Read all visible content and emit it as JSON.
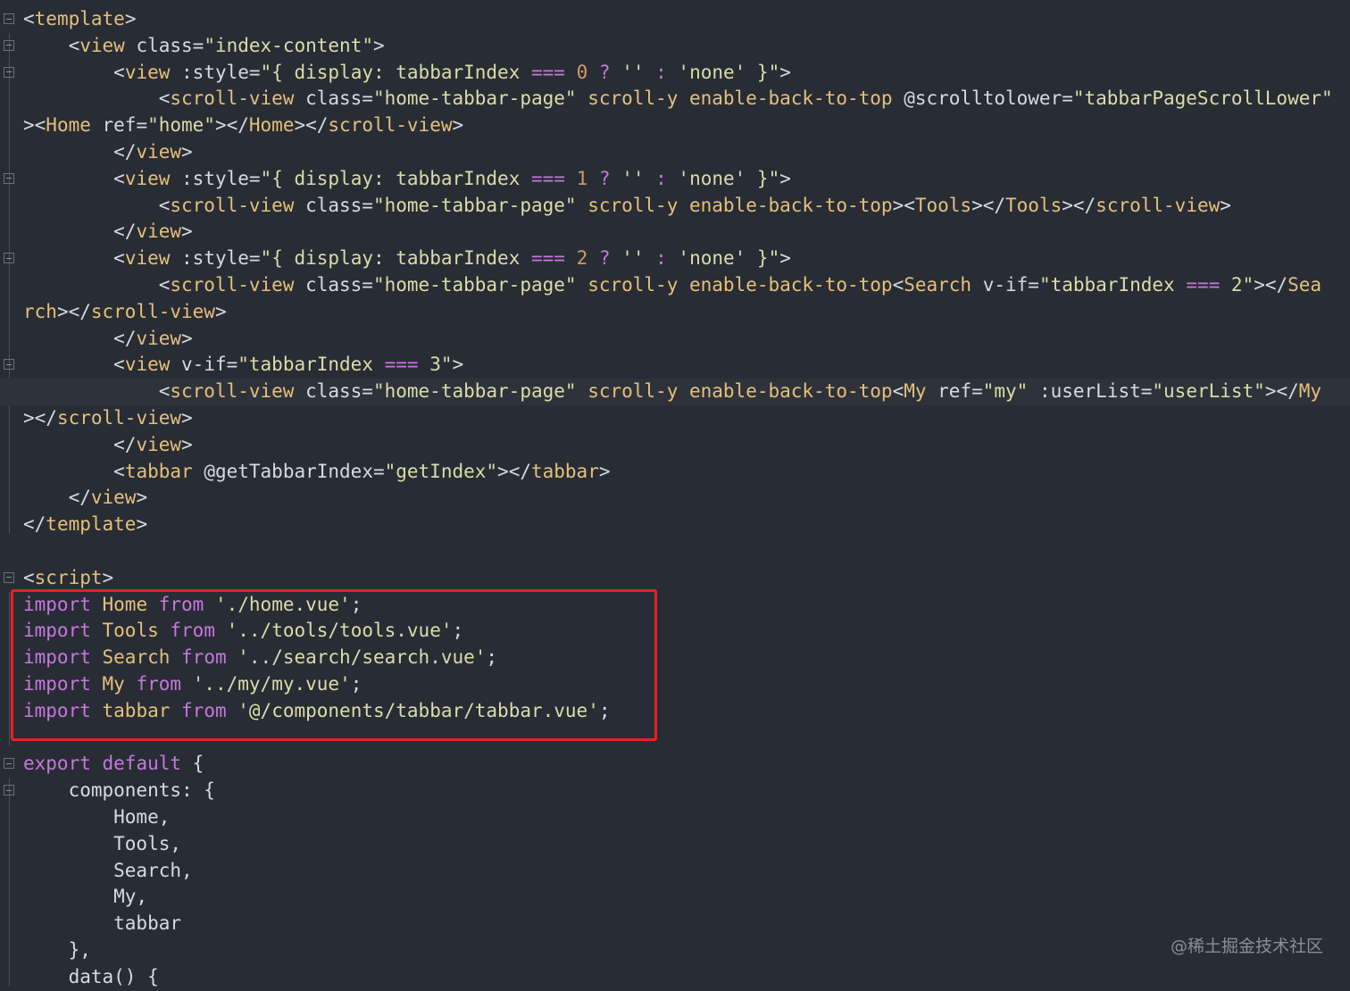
{
  "lines": [
    [
      [
        "t-bracket",
        "<"
      ],
      [
        "t-tag",
        "template"
      ],
      [
        "t-bracket",
        ">"
      ]
    ],
    [
      [
        "t-plain",
        "    "
      ],
      [
        "t-bracket",
        "<"
      ],
      [
        "t-tag",
        "view"
      ],
      [
        "t-attr",
        " class="
      ],
      [
        "t-str",
        "\"index-content\""
      ],
      [
        "t-bracket",
        ">"
      ]
    ],
    [
      [
        "t-plain",
        "        "
      ],
      [
        "t-bracket",
        "<"
      ],
      [
        "t-tag",
        "view"
      ],
      [
        "t-attr",
        " :style="
      ],
      [
        "t-str",
        "\"{ display: tabbarIndex "
      ],
      [
        "t-kw",
        "==="
      ],
      [
        "t-str",
        " "
      ],
      [
        "t-num",
        "0"
      ],
      [
        "t-str",
        " "
      ],
      [
        "t-kw",
        "?"
      ],
      [
        "t-str",
        " '' "
      ],
      [
        "t-kw",
        ":"
      ],
      [
        "t-str",
        " 'none' }\""
      ],
      [
        "t-bracket",
        ">"
      ]
    ],
    [
      [
        "t-plain",
        "            "
      ],
      [
        "t-bracket",
        "<"
      ],
      [
        "t-tag",
        "scroll-view"
      ],
      [
        "t-attr",
        " class="
      ],
      [
        "t-str",
        "\"home-tabbar-page\""
      ],
      [
        "t-tag",
        " scroll-y enable-back-to-top"
      ],
      [
        "t-attr",
        " @scrolltolower="
      ],
      [
        "t-str",
        "\"tabbarPageScrollLower\""
      ]
    ],
    [
      [
        "t-bracket",
        "><"
      ],
      [
        "t-tag",
        "Home"
      ],
      [
        "t-attr",
        " ref="
      ],
      [
        "t-str",
        "\"home\""
      ],
      [
        "t-bracket",
        "></"
      ],
      [
        "t-tag",
        "Home"
      ],
      [
        "t-bracket",
        "></"
      ],
      [
        "t-tag",
        "scroll-view"
      ],
      [
        "t-bracket",
        ">"
      ]
    ],
    [
      [
        "t-plain",
        "        "
      ],
      [
        "t-bracket",
        "</"
      ],
      [
        "t-tag",
        "view"
      ],
      [
        "t-bracket",
        ">"
      ]
    ],
    [
      [
        "t-plain",
        "        "
      ],
      [
        "t-bracket",
        "<"
      ],
      [
        "t-tag",
        "view"
      ],
      [
        "t-attr",
        " :style="
      ],
      [
        "t-str",
        "\"{ display: tabbarIndex "
      ],
      [
        "t-kw",
        "==="
      ],
      [
        "t-str",
        " "
      ],
      [
        "t-num",
        "1"
      ],
      [
        "t-str",
        " "
      ],
      [
        "t-kw",
        "?"
      ],
      [
        "t-str",
        " '' "
      ],
      [
        "t-kw",
        ":"
      ],
      [
        "t-str",
        " 'none' }\""
      ],
      [
        "t-bracket",
        ">"
      ]
    ],
    [
      [
        "t-plain",
        "            "
      ],
      [
        "t-bracket",
        "<"
      ],
      [
        "t-tag",
        "scroll-view"
      ],
      [
        "t-attr",
        " class="
      ],
      [
        "t-str",
        "\"home-tabbar-page\""
      ],
      [
        "t-tag",
        " scroll-y enable-back-to-top"
      ],
      [
        "t-bracket",
        "><"
      ],
      [
        "t-tag",
        "Tools"
      ],
      [
        "t-bracket",
        "></"
      ],
      [
        "t-tag",
        "Tools"
      ],
      [
        "t-bracket",
        "></"
      ],
      [
        "t-tag",
        "scroll-view"
      ],
      [
        "t-bracket",
        ">"
      ]
    ],
    [
      [
        "t-plain",
        "        "
      ],
      [
        "t-bracket",
        "</"
      ],
      [
        "t-tag",
        "view"
      ],
      [
        "t-bracket",
        ">"
      ]
    ],
    [
      [
        "t-plain",
        "        "
      ],
      [
        "t-bracket",
        "<"
      ],
      [
        "t-tag",
        "view"
      ],
      [
        "t-attr",
        " :style="
      ],
      [
        "t-str",
        "\"{ display: tabbarIndex "
      ],
      [
        "t-kw",
        "==="
      ],
      [
        "t-str",
        " "
      ],
      [
        "t-num",
        "2"
      ],
      [
        "t-str",
        " "
      ],
      [
        "t-kw",
        "?"
      ],
      [
        "t-str",
        " '' "
      ],
      [
        "t-kw",
        ":"
      ],
      [
        "t-str",
        " 'none' }\""
      ],
      [
        "t-bracket",
        ">"
      ]
    ],
    [
      [
        "t-plain",
        "            "
      ],
      [
        "t-bracket",
        "<"
      ],
      [
        "t-tag",
        "scroll-view"
      ],
      [
        "t-attr",
        " class="
      ],
      [
        "t-str",
        "\"home-tabbar-page\""
      ],
      [
        "t-tag",
        " scroll-y enable-back-to-top"
      ],
      [
        "t-bracket",
        "<"
      ],
      [
        "t-tag",
        "Search"
      ],
      [
        "t-attr",
        " v-if="
      ],
      [
        "t-str",
        "\"tabbarIndex "
      ],
      [
        "t-kw",
        "==="
      ],
      [
        "t-str",
        " 2\""
      ],
      [
        "t-bracket",
        "></"
      ],
      [
        "t-tag",
        "Sea"
      ]
    ],
    [
      [
        "t-tag",
        "rch"
      ],
      [
        "t-bracket",
        "></"
      ],
      [
        "t-tag",
        "scroll-view"
      ],
      [
        "t-bracket",
        ">"
      ]
    ],
    [
      [
        "t-plain",
        "        "
      ],
      [
        "t-bracket",
        "</"
      ],
      [
        "t-tag",
        "view"
      ],
      [
        "t-bracket",
        ">"
      ]
    ],
    [
      [
        "t-plain",
        "        "
      ],
      [
        "t-bracket",
        "<"
      ],
      [
        "t-tag",
        "view"
      ],
      [
        "t-attr",
        " v-if="
      ],
      [
        "t-str",
        "\"tabbarIndex "
      ],
      [
        "t-kw",
        "==="
      ],
      [
        "t-str",
        " 3\""
      ],
      [
        "t-bracket",
        ">"
      ]
    ],
    [
      [
        "t-plain",
        "            "
      ],
      [
        "t-bracket",
        "<"
      ],
      [
        "t-tag",
        "scroll-view"
      ],
      [
        "t-attr",
        " class="
      ],
      [
        "t-str",
        "\"home-tabbar-page\""
      ],
      [
        "t-tag",
        " scroll-y enable-back-to-top"
      ],
      [
        "t-bracket",
        "<"
      ],
      [
        "t-tag",
        "My"
      ],
      [
        "t-attr",
        " ref="
      ],
      [
        "t-str",
        "\"my\""
      ],
      [
        "t-attr",
        " :userList="
      ],
      [
        "t-str",
        "\"userList\""
      ],
      [
        "t-bracket",
        "></"
      ],
      [
        "t-tag",
        "My"
      ]
    ],
    [
      [
        "t-bracket",
        "></"
      ],
      [
        "t-tag",
        "scroll-view"
      ],
      [
        "t-bracket",
        ">"
      ]
    ],
    [
      [
        "t-plain",
        "        "
      ],
      [
        "t-bracket",
        "</"
      ],
      [
        "t-tag",
        "view"
      ],
      [
        "t-bracket",
        ">"
      ]
    ],
    [
      [
        "t-plain",
        "        "
      ],
      [
        "t-bracket",
        "<"
      ],
      [
        "t-tag",
        "tabbar"
      ],
      [
        "t-attr",
        " @getTabbarIndex="
      ],
      [
        "t-str",
        "\"getIndex\""
      ],
      [
        "t-bracket",
        "></"
      ],
      [
        "t-tag",
        "tabbar"
      ],
      [
        "t-bracket",
        ">"
      ]
    ],
    [
      [
        "t-plain",
        "    "
      ],
      [
        "t-bracket",
        "</"
      ],
      [
        "t-tag",
        "view"
      ],
      [
        "t-bracket",
        ">"
      ]
    ],
    [
      [
        "t-bracket",
        "</"
      ],
      [
        "t-tag",
        "template"
      ],
      [
        "t-bracket",
        ">"
      ]
    ],
    [],
    [
      [
        "t-bracket",
        "<"
      ],
      [
        "t-tag",
        "script"
      ],
      [
        "t-bracket",
        ">"
      ]
    ],
    [
      [
        "t-kw",
        "import"
      ],
      [
        "t-plain",
        " "
      ],
      [
        "t-ident",
        "Home"
      ],
      [
        "t-plain",
        " "
      ],
      [
        "t-kw",
        "from"
      ],
      [
        "t-plain",
        " "
      ],
      [
        "t-str",
        "'./home.vue'"
      ],
      [
        "t-punc",
        ";"
      ]
    ],
    [
      [
        "t-kw",
        "import"
      ],
      [
        "t-plain",
        " "
      ],
      [
        "t-ident",
        "Tools"
      ],
      [
        "t-plain",
        " "
      ],
      [
        "t-kw",
        "from"
      ],
      [
        "t-plain",
        " "
      ],
      [
        "t-str",
        "'../tools/tools.vue'"
      ],
      [
        "t-punc",
        ";"
      ]
    ],
    [
      [
        "t-kw",
        "import"
      ],
      [
        "t-plain",
        " "
      ],
      [
        "t-ident",
        "Search"
      ],
      [
        "t-plain",
        " "
      ],
      [
        "t-kw",
        "from"
      ],
      [
        "t-plain",
        " "
      ],
      [
        "t-str",
        "'../search/search.vue'"
      ],
      [
        "t-punc",
        ";"
      ]
    ],
    [
      [
        "t-kw",
        "import"
      ],
      [
        "t-plain",
        " "
      ],
      [
        "t-ident",
        "My"
      ],
      [
        "t-plain",
        " "
      ],
      [
        "t-kw",
        "from"
      ],
      [
        "t-plain",
        " "
      ],
      [
        "t-str",
        "'../my/my.vue'"
      ],
      [
        "t-punc",
        ";"
      ]
    ],
    [
      [
        "t-kw",
        "import"
      ],
      [
        "t-plain",
        " "
      ],
      [
        "t-ident",
        "tabbar"
      ],
      [
        "t-plain",
        " "
      ],
      [
        "t-kw",
        "from"
      ],
      [
        "t-plain",
        " "
      ],
      [
        "t-str",
        "'@/components/tabbar/tabbar.vue'"
      ],
      [
        "t-punc",
        ";"
      ]
    ],
    [],
    [
      [
        "t-kw",
        "export"
      ],
      [
        "t-plain",
        " "
      ],
      [
        "t-kw",
        "default"
      ],
      [
        "t-plain",
        " {"
      ]
    ],
    [
      [
        "t-plain",
        "    components: {"
      ]
    ],
    [
      [
        "t-plain",
        "        Home,"
      ]
    ],
    [
      [
        "t-plain",
        "        Tools,"
      ]
    ],
    [
      [
        "t-plain",
        "        Search,"
      ]
    ],
    [
      [
        "t-plain",
        "        My,"
      ]
    ],
    [
      [
        "t-plain",
        "        tabbar"
      ]
    ],
    [
      [
        "t-plain",
        "    },"
      ]
    ],
    [
      [
        "t-plain",
        "    data() {"
      ]
    ]
  ],
  "watermark": "@稀土掘金技术社区"
}
